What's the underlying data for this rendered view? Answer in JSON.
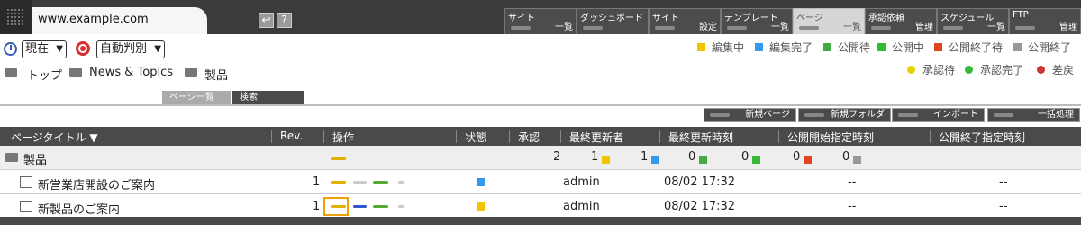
{
  "header": {
    "site_url": "www.example.com",
    "icons": [
      "back-icon",
      "help-icon"
    ],
    "help_label": "?",
    "nav": [
      {
        "t1": "サイト",
        "t2": "一覧",
        "active": false
      },
      {
        "t1": "ダッシュボード",
        "t2": "",
        "active": false
      },
      {
        "t1": "サイト",
        "t2": "設定",
        "active": false
      },
      {
        "t1": "テンプレート",
        "t2": "一覧",
        "active": false
      },
      {
        "t1": "ページ",
        "t2": "一覧",
        "active": true
      },
      {
        "t1": "承認依頼",
        "t2": "管理",
        "active": false
      },
      {
        "t1": "スケジュール",
        "t2": "一覧",
        "active": false
      },
      {
        "t1": "FTP",
        "t2": "管理",
        "active": false
      }
    ]
  },
  "controls": {
    "time_select": "現在",
    "judge_select": "自動判別"
  },
  "breadcrumb": [
    "トップ",
    "News & Topics",
    "製品"
  ],
  "legend": {
    "status": [
      {
        "label": "編集中",
        "color": "#f0c400"
      },
      {
        "label": "編集完了",
        "color": "#3399ee"
      },
      {
        "label": "公開待",
        "color": "#44aa44"
      },
      {
        "label": "公開中",
        "color": "#33bb33"
      },
      {
        "label": "公開終了待",
        "color": "#dd4422"
      },
      {
        "label": "公開終了",
        "color": "#999999"
      }
    ],
    "approval": [
      {
        "label": "承認待",
        "color": "#e8d000"
      },
      {
        "label": "承認完了",
        "color": "#33bb33"
      },
      {
        "label": "差戻",
        "color": "#cc3333"
      }
    ]
  },
  "tabs": [
    "ページ一覧",
    "検索"
  ],
  "actions": [
    "新規ページ",
    "新規フォルダ",
    "インポート",
    "一括処理"
  ],
  "table": {
    "headers": [
      "ページタイトル ▼",
      "Rev.",
      "操作",
      "状態",
      "承認",
      "最終更新者",
      "最終更新時刻",
      "公開開始指定時刻",
      "公開終了指定時刻"
    ],
    "folder": {
      "name": "製品",
      "counts": [
        "2",
        "1",
        "1",
        "0",
        "0",
        "0",
        "0"
      ]
    },
    "rows": [
      {
        "title": "新営業店開設のご案内",
        "rev": "1",
        "updater": "admin",
        "time": "08/02 17:32",
        "start": "--",
        "end": "--"
      },
      {
        "title": "新製品のご案内",
        "rev": "1",
        "updater": "admin",
        "time": "08/02 17:32",
        "start": "--",
        "end": "--"
      }
    ]
  }
}
